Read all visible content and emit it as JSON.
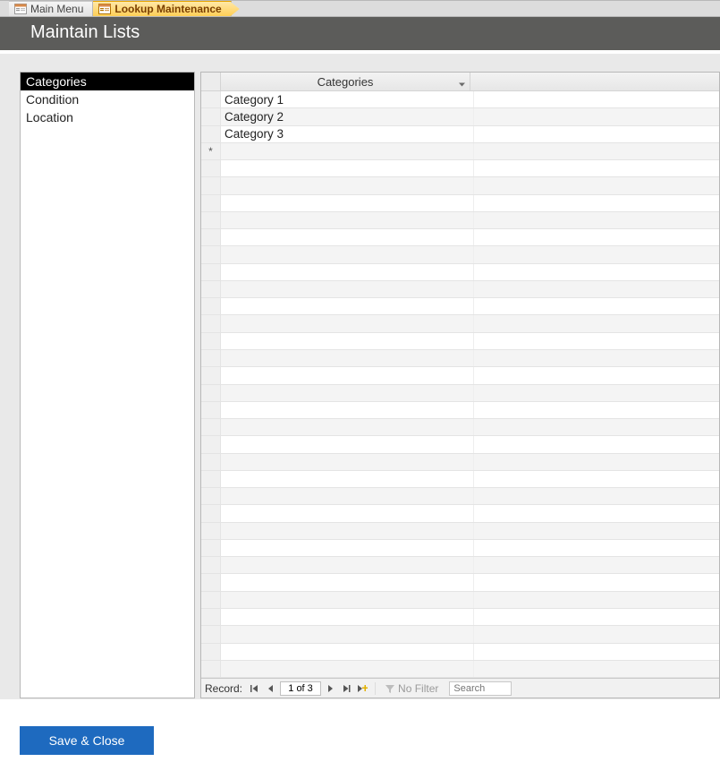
{
  "tabs": [
    {
      "label": "Main Menu",
      "active": false
    },
    {
      "label": "Lookup Maintenance",
      "active": true
    }
  ],
  "header": {
    "title": "Maintain Lists"
  },
  "listbox": {
    "items": [
      "Categories",
      "Condition",
      "Location"
    ],
    "selected_index": 0
  },
  "datasheet": {
    "column_header": "Categories",
    "rows": [
      "Category 1",
      "Category 2",
      "Category 3"
    ],
    "new_row_marker": "*"
  },
  "nav": {
    "label": "Record:",
    "position": "1 of 3",
    "no_filter": "No Filter",
    "search_placeholder": "Search"
  },
  "buttons": {
    "save_close": "Save & Close"
  }
}
